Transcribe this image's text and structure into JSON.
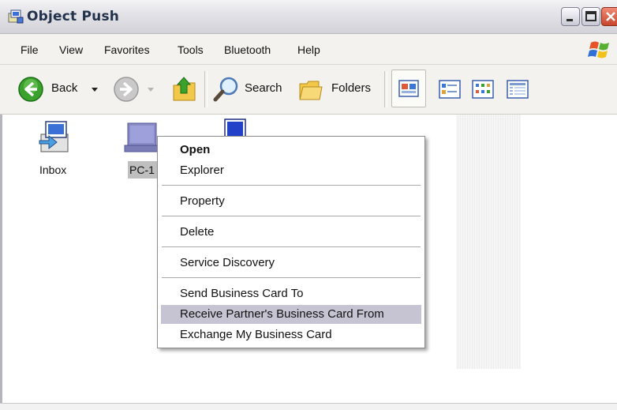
{
  "window": {
    "title": "Object Push",
    "controls": [
      "minimize",
      "maximize",
      "close"
    ]
  },
  "menubar": {
    "items": [
      "File",
      "View",
      "Favorites",
      "Tools",
      "Bluetooth",
      "Help"
    ]
  },
  "toolbar": {
    "back_label": "Back",
    "search_label": "Search",
    "folders_label": "Folders",
    "view_buttons": [
      "thumbnails-view",
      "tiles-view",
      "icons-view",
      "details-view"
    ]
  },
  "files": [
    {
      "label": "Inbox",
      "icon": "inbox-icon"
    },
    {
      "label": "PC-1",
      "icon": "laptop-icon",
      "selected": true
    },
    {
      "label": "",
      "icon": "device-icon"
    }
  ],
  "context_menu": {
    "groups": [
      [
        {
          "label": "Open",
          "bold": true
        },
        {
          "label": "Explorer"
        }
      ],
      [
        {
          "label": "Property"
        }
      ],
      [
        {
          "label": "Delete"
        }
      ],
      [
        {
          "label": "Service Discovery"
        }
      ],
      [
        {
          "label": "Send Business Card To"
        },
        {
          "label": "Receive Partner's Business Card From",
          "highlighted": true
        },
        {
          "label": "Exchange My Business Card"
        }
      ]
    ]
  },
  "colors": {
    "highlight": "#c6c3d3",
    "selection": "#bfbfbf",
    "title_text": "#22324a"
  }
}
